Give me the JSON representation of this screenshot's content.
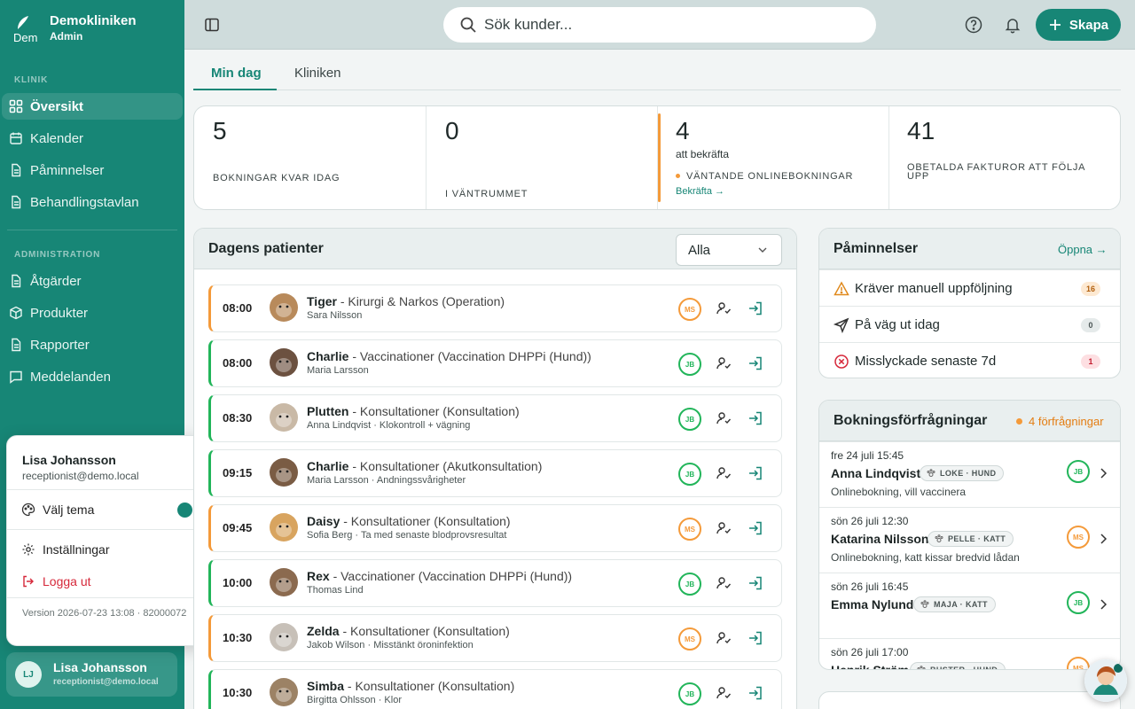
{
  "clinic": {
    "name": "Demokliniken",
    "role": "Admin",
    "logo_text": "Dem"
  },
  "nav": {
    "section_clinic": "KLINIK",
    "section_admin": "ADMINISTRATION",
    "items": [
      {
        "label": "Översikt",
        "icon": "grid-icon",
        "active": true
      },
      {
        "label": "Kalender",
        "icon": "calendar-icon"
      },
      {
        "label": "Påminnelser",
        "icon": "document-icon"
      },
      {
        "label": "Behandlingstavlan",
        "icon": "document-icon"
      },
      {
        "label": "Åtgärder",
        "icon": "document-icon"
      },
      {
        "label": "Produkter",
        "icon": "box-icon"
      },
      {
        "label": "Rapporter",
        "icon": "document-icon"
      },
      {
        "label": "Meddelanden",
        "icon": "message-icon"
      }
    ]
  },
  "user": {
    "name": "Lisa Johansson",
    "email": "receptionist@demo.local",
    "initials": "LJ"
  },
  "user_menu": {
    "name": "Lisa Johansson",
    "email": "receptionist@demo.local",
    "theme": "Välj tema",
    "theme_color": "#178676",
    "settings": "Inställningar",
    "logout": "Logga ut",
    "version": "Version 2026-07-23 13:08 · 82000072"
  },
  "topbar": {
    "search_placeholder": "Sök kunder...",
    "create_label": "Skapa"
  },
  "tabs": [
    {
      "label": "Min dag",
      "active": true
    },
    {
      "label": "Kliniken"
    }
  ],
  "stats": [
    {
      "value": "5",
      "label": "BOKNINGAR KVAR IDAG"
    },
    {
      "value": "0",
      "label": "I VÄNTRUMMET"
    },
    {
      "value": "4",
      "sub": "att bekräfta",
      "label": "VÄNTANDE ONLINEBOKNINGAR",
      "link": "Bekräfta →"
    },
    {
      "value": "41",
      "label": "OBETALDA FAKTUROR ATT FÖLJA UPP"
    }
  ],
  "patients": {
    "title": "Dagens patienter",
    "filter": "Alla",
    "rows": [
      {
        "time": "08:00",
        "pet": "Tiger",
        "service": " - Kirurgi & Narkos (Operation)",
        "owner": "Sara Nilsson",
        "staff": "MS",
        "status": "orange"
      },
      {
        "time": "08:00",
        "pet": "Charlie",
        "service": " - Vaccinationer (Vaccination DHPPi (Hund))",
        "owner": "Maria Larsson",
        "staff": "JB",
        "status": "green"
      },
      {
        "time": "08:30",
        "pet": "Plutten",
        "service": " - Konsultationer (Konsultation)",
        "owner": "Anna Lindqvist · Klokontroll + vägning",
        "staff": "JB",
        "status": "green"
      },
      {
        "time": "09:15",
        "pet": "Charlie",
        "service": " - Konsultationer (Akutkonsultation)",
        "owner": "Maria Larsson · Andningssvårigheter",
        "staff": "JB",
        "status": "green"
      },
      {
        "time": "09:45",
        "pet": "Daisy",
        "service": " - Konsultationer (Konsultation)",
        "owner": "Sofia Berg · Ta med senaste blodprovsresultat",
        "staff": "MS",
        "status": "orange"
      },
      {
        "time": "10:00",
        "pet": "Rex",
        "service": " - Vaccinationer (Vaccination DHPPi (Hund))",
        "owner": "Thomas Lind",
        "staff": "JB",
        "status": "green"
      },
      {
        "time": "10:30",
        "pet": "Zelda",
        "service": " - Konsultationer (Konsultation)",
        "owner": "Jakob Wilson · Misstänkt öroninfektion",
        "staff": "MS",
        "status": "orange"
      },
      {
        "time": "10:30",
        "pet": "Simba",
        "service": " - Konsultationer (Konsultation)",
        "owner": "Birgitta Ohlsson · Klor",
        "staff": "JB",
        "status": "green"
      }
    ]
  },
  "reminders": {
    "title": "Påminnelser",
    "open": "Öppna →",
    "items": [
      {
        "label": "Kräver manuell uppföljning",
        "count": "16",
        "icon": "warning-icon"
      },
      {
        "label": "På väg ut idag",
        "count": "0",
        "icon": "send-icon"
      },
      {
        "label": "Misslyckade senaste 7d",
        "count": "1",
        "icon": "error-icon"
      }
    ]
  },
  "bookings": {
    "title": "Bokningsförfrågningar",
    "count_label": "4 förfrågningar",
    "items": [
      {
        "date": "fre 24 juli 15:45",
        "name": "Anna Lindqvist",
        "tag": "LOKE · HUND",
        "desc": "Onlinebokning, vill vaccinera",
        "staff": "JB"
      },
      {
        "date": "sön 26 juli 12:30",
        "name": "Katarina Nilsson",
        "tag": "PELLE · KATT",
        "desc": "Onlinebokning, katt kissar bredvid lådan",
        "staff": "MS"
      },
      {
        "date": "sön 26 juli 16:45",
        "name": "Emma Nylund",
        "tag": "MAJA · KATT",
        "desc": "",
        "staff": "JB"
      },
      {
        "date": "sön 26 juli 17:00",
        "name": "Henrik Ström",
        "tag": "BUSTER · HUND",
        "desc": "",
        "staff": "MS"
      }
    ]
  },
  "colors": {
    "brand": "#178676",
    "green": "#22b55a",
    "orange": "#f49a3a"
  }
}
